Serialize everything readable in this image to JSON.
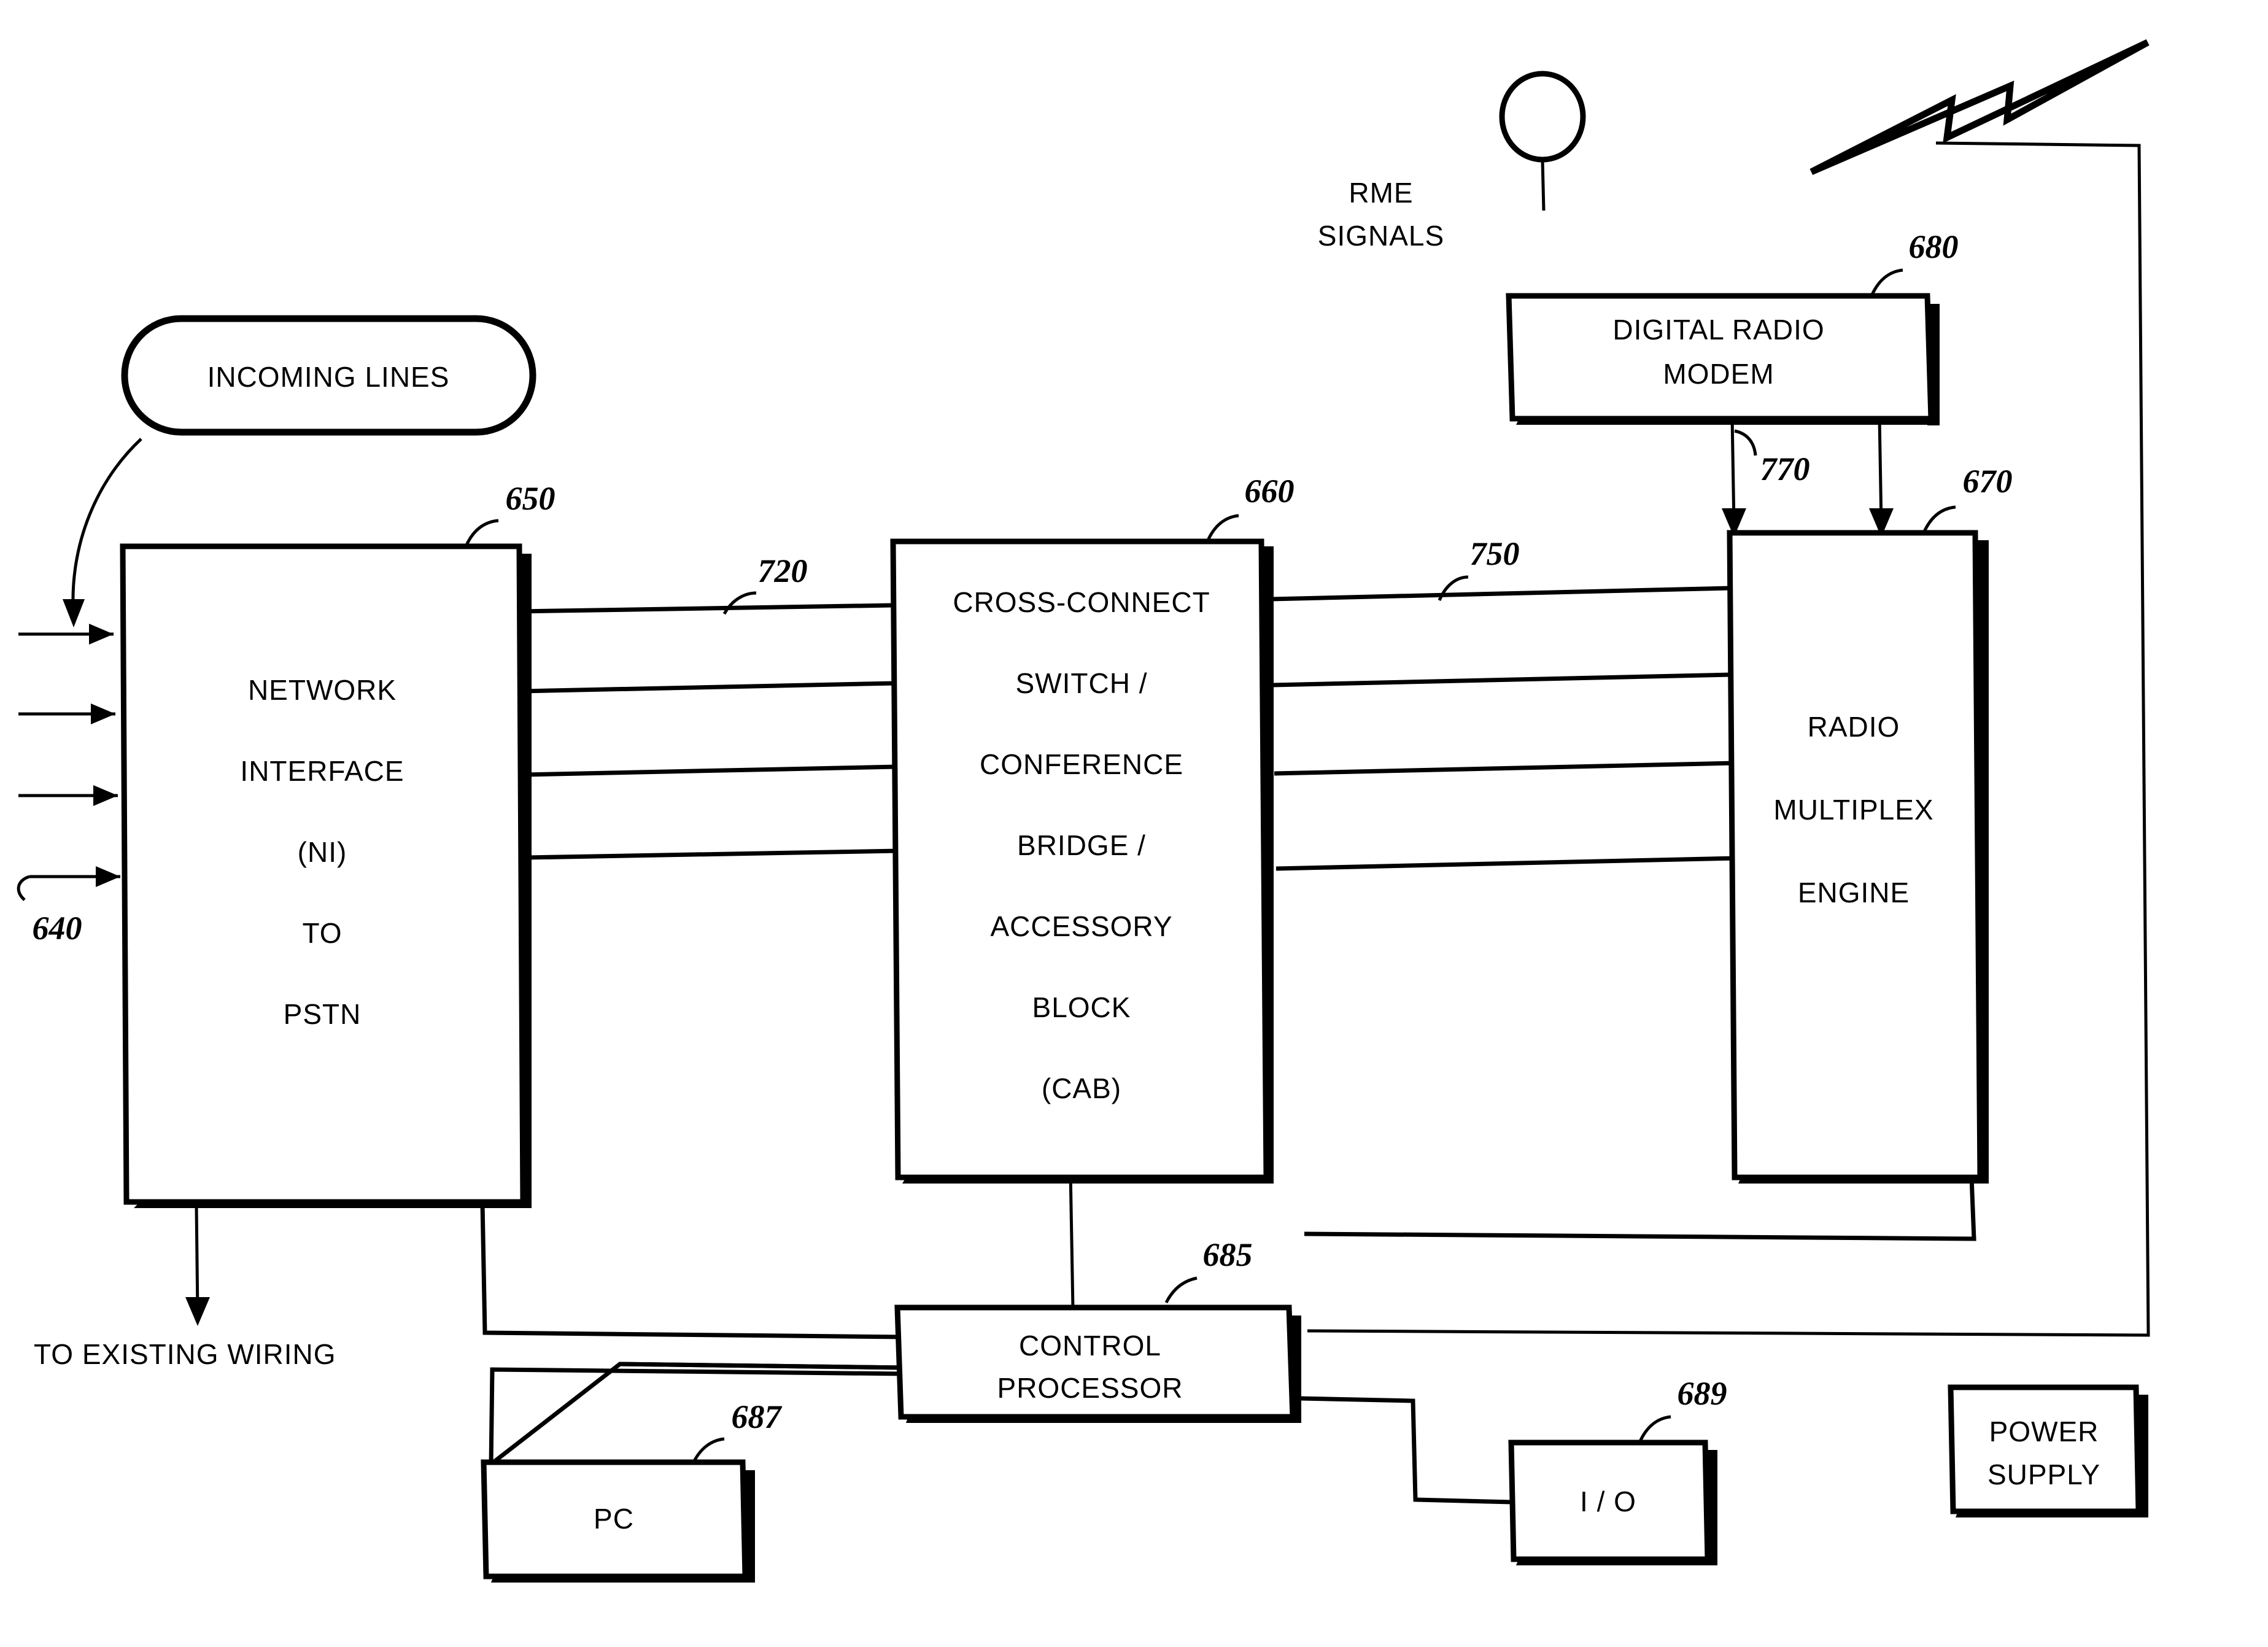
{
  "figure": {
    "type": "patent-block-diagram",
    "background": "#ffffff",
    "ink": "#000000"
  },
  "blocks": {
    "incoming_lines": {
      "label": "INCOMING LINES",
      "shape": "stadium"
    },
    "network_interface": {
      "lines": [
        "NETWORK",
        "INTERFACE",
        "(NI)",
        "TO",
        "PSTN"
      ],
      "ref": "650"
    },
    "cab": {
      "lines": [
        "CROSS-CONNECT",
        "SWITCH /",
        "CONFERENCE",
        "BRIDGE /",
        "ACCESSORY",
        "BLOCK",
        "(CAB)"
      ],
      "ref": "660"
    },
    "rme": {
      "lines": [
        "RADIO",
        "MULTIPLEX",
        "ENGINE"
      ],
      "ref": "670"
    },
    "digital_radio_modem": {
      "lines": [
        "DIGITAL RADIO",
        "MODEM"
      ],
      "ref": "680"
    },
    "control_processor": {
      "lines": [
        "CONTROL",
        "PROCESSOR"
      ],
      "ref": "685"
    },
    "pc": {
      "label": "PC",
      "ref": "687"
    },
    "io": {
      "label": "I / O",
      "ref": "689"
    },
    "power_supply": {
      "lines": [
        "POWER",
        "SUPPLY"
      ]
    }
  },
  "annotations": {
    "rme_signals": [
      "RME",
      "SIGNALS"
    ],
    "to_existing_wiring": "TO EXISTING WIRING",
    "ref_incoming_lines_group": "640",
    "ref_ni_to_cab_bus": "720",
    "ref_cab_to_rme_bus": "750",
    "ref_modem_to_rme": "770"
  },
  "icons": {
    "antenna": "antenna-circle-icon",
    "rf_burst": "lightning-bolt-icon"
  }
}
